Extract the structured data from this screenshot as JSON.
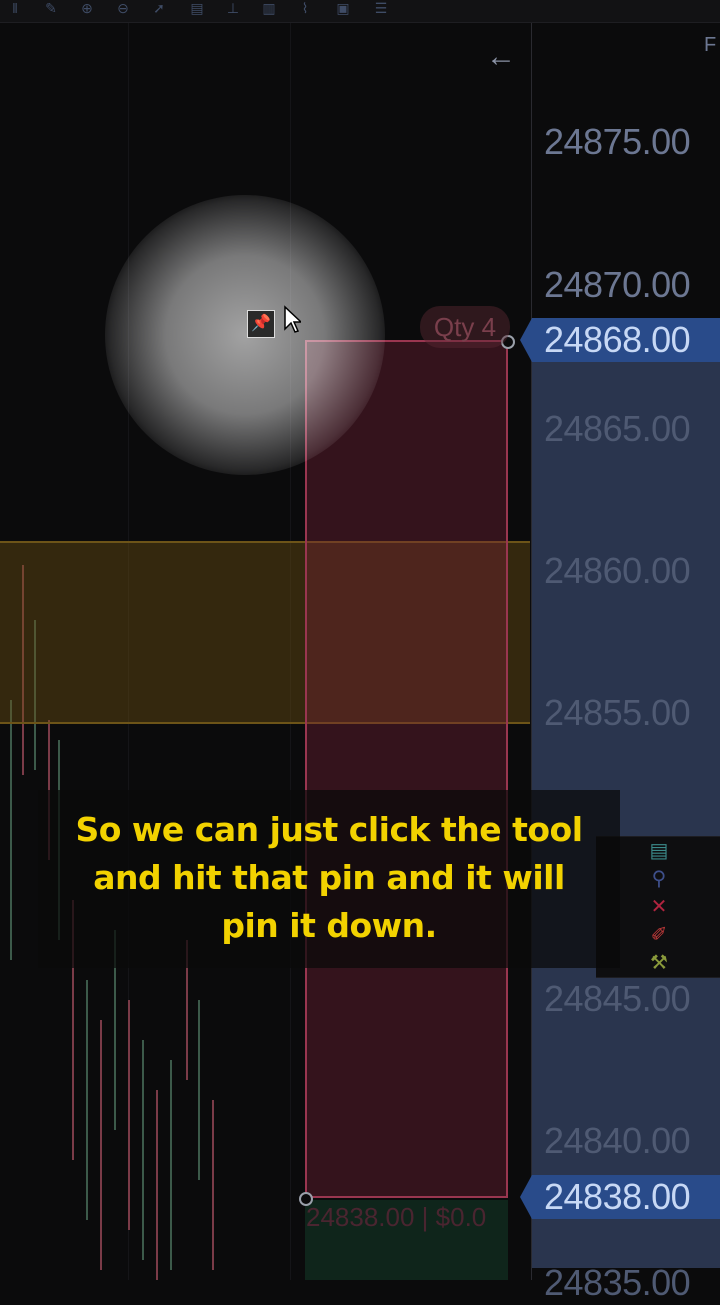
{
  "toolbar": {
    "icons": [
      "bars-icon",
      "pencil-icon",
      "zoom-in-icon",
      "zoom-out-icon",
      "cursor-icon",
      "layers-icon",
      "drawing-tools-icon",
      "chart-bars-icon",
      "trend-icon",
      "snapshot-icon",
      "list-icon"
    ]
  },
  "chart": {
    "back_arrow": "←",
    "top_right_letter": "F",
    "qty_label": "Qty 4",
    "stop_label": "24838.00 | $0.0",
    "price_axis": {
      "labels": [
        "24875.00",
        "24870.00",
        "24865.00",
        "24860.00",
        "24855.00",
        "24845.00",
        "24840.00",
        "24835.00"
      ],
      "current_price_tags": [
        "24868.00",
        "24838.00"
      ]
    }
  },
  "caption": {
    "line1": "So we can just click the tool",
    "line2": "and hit that pin and it will",
    "line3": "pin it down."
  },
  "colors": {
    "caption_text": "#f2d200",
    "position_box": "#9a3650",
    "zone": "#6d5418",
    "price_tag": "#294b8a"
  }
}
